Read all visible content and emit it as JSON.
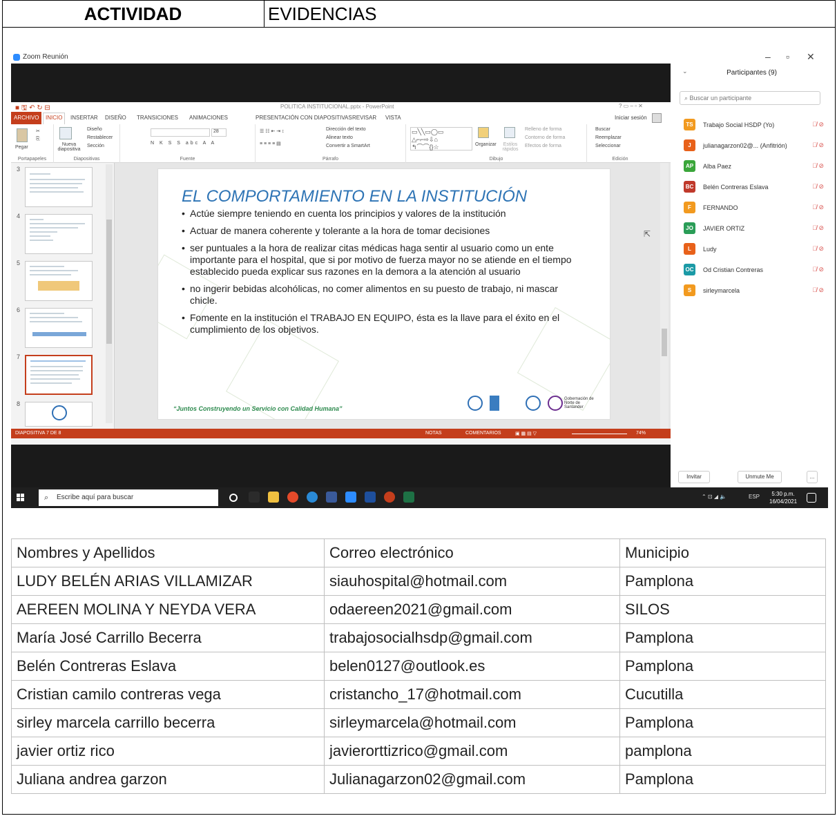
{
  "header": {
    "col1": "ACTIVIDAD",
    "col2": "EVIDENCIAS"
  },
  "zoom": {
    "window_title": "Zoom Reunión",
    "participants_title": "Participantes (9)",
    "search_placeholder": "Buscar un participante",
    "participants": [
      {
        "initials": "TS",
        "name": "Trabajo Social HSDP (Yo)",
        "color": "#f29a1f"
      },
      {
        "initials": "J",
        "name": "julianagarzon02@...  (Anfitrión)",
        "color": "#e8611a"
      },
      {
        "initials": "AP",
        "name": "Alba Paez",
        "color": "#3aa63a"
      },
      {
        "initials": "BC",
        "name": "Belén Contreras Eslava",
        "color": "#c0392b"
      },
      {
        "initials": "F",
        "name": "FERNANDO",
        "color": "#f29a1f"
      },
      {
        "initials": "JO",
        "name": "JAVIER  ORTIZ",
        "color": "#2a9d57"
      },
      {
        "initials": "L",
        "name": "Ludy",
        "color": "#e8611a"
      },
      {
        "initials": "OC",
        "name": "Od Cristian Contreras",
        "color": "#1b9aa6"
      },
      {
        "initials": "S",
        "name": "sirleymarcela",
        "color": "#f29a1f"
      }
    ],
    "buttons": {
      "invite": "Invitar",
      "unmute": "Unmute Me",
      "more": "..."
    }
  },
  "powerpoint": {
    "title": "POLITICA INSTITUCIONAL.pptx - PowerPoint",
    "signin": "Iniciar sesión",
    "tabs": [
      "ARCHIVO",
      "INICIO",
      "INSERTAR",
      "DISEÑO",
      "TRANSICIONES",
      "ANIMACIONES",
      "PRESENTACIÓN CON DIAPOSITIVAS",
      "REVISAR",
      "VISTA"
    ],
    "ribbon": {
      "portapapeles": "Portapapeles",
      "pegar": "Pegar",
      "diapositivas": "Diapositivas",
      "nueva": "Nueva diapositiva",
      "diseno": "Diseño",
      "restablecer": "Restablecer",
      "seccion": "Sección",
      "fuente": "Fuente",
      "parrafo": "Párrafo",
      "direccion": "Dirección del texto",
      "alinear": "Alinear texto",
      "smartart": "Convertir a SmartArt",
      "dibujo": "Dibujo",
      "organizar": "Organizar",
      "estilos": "Estilos rápidos",
      "relleno": "Relleno de forma",
      "contorno": "Contorno de forma",
      "efectos": "Efectos de forma",
      "edicion": "Edición",
      "buscar": "Buscar",
      "reemplazar": "Reemplazar",
      "seleccionar": "Seleccionar"
    },
    "thumb_numbers": [
      "3",
      "4",
      "5",
      "6",
      "7",
      "8"
    ],
    "slide": {
      "title": "EL COMPORTAMIENTO EN LA INSTITUCIÓN",
      "bullets": [
        "Actúe siempre teniendo en cuenta los principios y valores de la institución",
        "Actuar de manera coherente y tolerante a la hora de tomar decisiones",
        "ser puntuales a la hora de realizar citas médicas haga sentir al usuario como un ente importante para el hospital, que si por motivo de fuerza mayor no se atiende en el tiempo establecido pueda explicar sus razones en la demora a la atención al usuario",
        "no ingerir bebidas alcohólicas, no comer alimentos en su puesto de trabajo, ni mascar chicle.",
        "Fomente en la institución el TRABAJO EN EQUIPO, ésta es la llave para el éxito en el cumplimiento de los objetivos."
      ],
      "footer": "“Juntos Construyendo un Servicio con Calidad Humana”",
      "logo_text": "Gobernación de Norte de Santander"
    },
    "status": {
      "slide": "DIAPOSITIVA 7 DE 8",
      "notas": "NOTAS",
      "comentarios": "COMENTARIOS",
      "zoom": "74%"
    }
  },
  "taskbar": {
    "search": "Escribe aquí para buscar",
    "lang": "ESP",
    "time": "5:30 p.m.",
    "date": "16/04/2021"
  },
  "table": {
    "headers": [
      "Nombres y Apellidos",
      "Correo electrónico",
      "Municipio"
    ],
    "rows": [
      [
        "LUDY BELÉN ARIAS VILLAMIZAR",
        "siauhospital@hotmail.com",
        "Pamplona"
      ],
      [
        "AEREEN MOLINA Y NEYDA VERA",
        "odaereen2021@gmail.com",
        "SILOS"
      ],
      [
        "María José Carrillo Becerra",
        "trabajosocialhsdp@gmail.com",
        "Pamplona"
      ],
      [
        "Belén Contreras Eslava",
        "belen0127@outlook.es",
        "Pamplona"
      ],
      [
        "Cristian camilo contreras vega",
        "cristancho_17@hotmail.com",
        "Cucutilla"
      ],
      [
        "sirley marcela carrillo becerra",
        "sirleymarcela@hotmail.com",
        "Pamplona"
      ],
      [
        "javier ortiz rico",
        "javierorttizrico@gmail.com",
        "pamplona"
      ],
      [
        "Juliana andrea garzon",
        "Julianagarzon02@gmail.com",
        "Pamplona"
      ]
    ]
  }
}
